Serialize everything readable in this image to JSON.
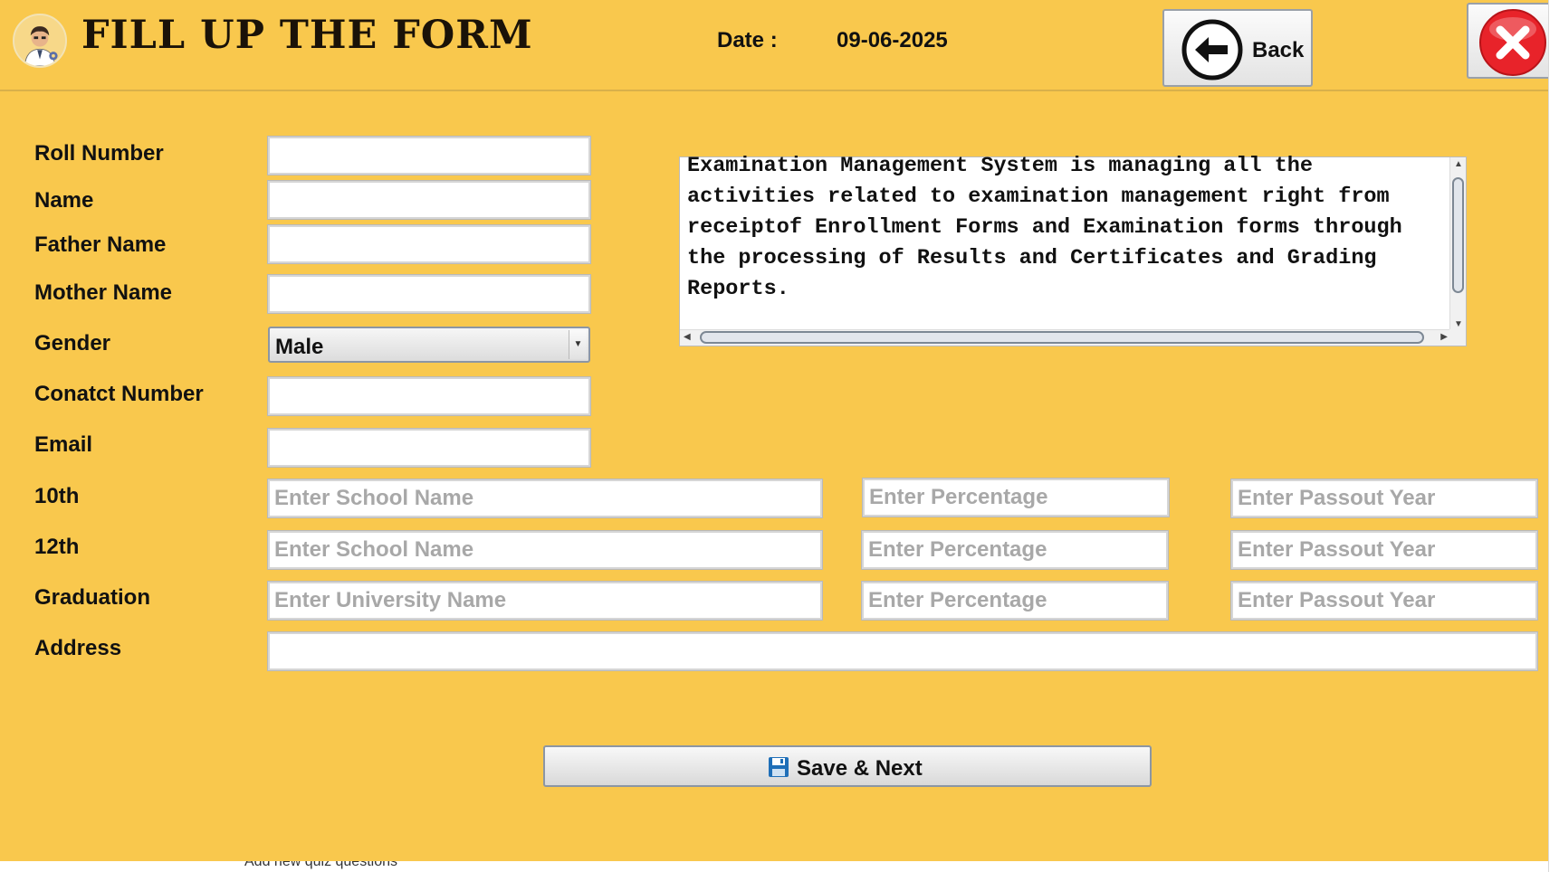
{
  "header": {
    "title": "FILL UP THE FORM",
    "date_label": "Date :",
    "date_value": "09-06-2025",
    "back_label": "Back"
  },
  "form": {
    "labels": {
      "roll_number": "Roll Number",
      "name": "Name",
      "father_name": "Father Name",
      "mother_name": "Mother Name",
      "gender": "Gender",
      "contact_number": "Conatct Number",
      "email": "Email",
      "tenth": "10th",
      "twelfth": "12th",
      "graduation": "Graduation",
      "address": "Address"
    },
    "values": {
      "roll_number": "",
      "name": "",
      "father_name": "",
      "mother_name": "",
      "contact_number": "",
      "email": "",
      "address": ""
    },
    "gender_selected": "Male",
    "placeholders": {
      "school_name": "Enter School Name",
      "university_name": "Enter University Name",
      "percentage": "Enter Percentage",
      "passout_year": "Enter Passout Year"
    }
  },
  "description": "Examination Management System is managing all the\nactivities related to examination management right from\nreceiptof Enrollment Forms and Examination forms through\nthe processing of Results and Certificates and Grading\nReports.",
  "save_button_label": "Save & Next",
  "background_window_text": "Add new quiz questions",
  "colors": {
    "background": "#f9c84d",
    "close_red": "#e8232a"
  },
  "icons": {
    "logo": "student-avatar-icon",
    "back": "arrow-left-circle-icon",
    "close": "red-x-close-icon",
    "save": "floppy-disk-icon"
  }
}
